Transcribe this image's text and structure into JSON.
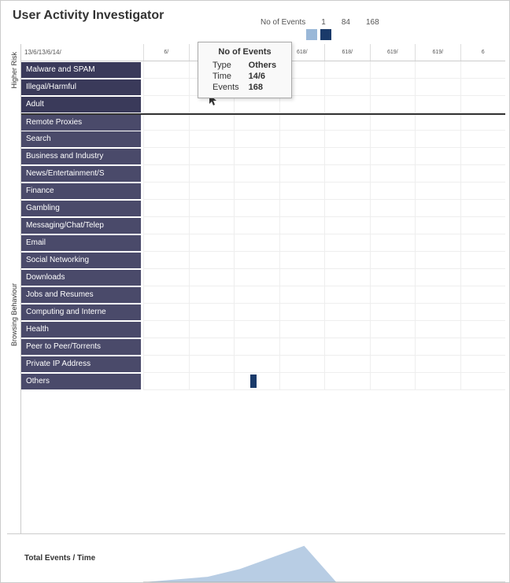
{
  "title": "User Activity Investigator",
  "legend": {
    "label": "No of Events",
    "values": [
      "1",
      "84",
      "168"
    ],
    "colors": [
      "#9ab8d8",
      "#1a3a6a"
    ]
  },
  "timeHeader": "13/6/13/6/14/",
  "timeHeaderRight": "6/617/617/618/618/619/619/6",
  "categories": {
    "higherRisk": {
      "label": "Higher Risk",
      "items": [
        "Malware and SPAM",
        "Illegal/Harmful",
        "Adult"
      ]
    },
    "browsing": {
      "label": "Browsing Behaviour",
      "items": [
        "Remote Proxies",
        "Search",
        "Business and Industry",
        "News/Entertainment/S",
        "Finance",
        "Gambling",
        "Messaging/Chat/Telep",
        "Email",
        "Social Networking",
        "Downloads",
        "Jobs and Resumes",
        "Computing and Interne",
        "Health",
        "Peer to Peer/Torrents",
        "Private IP Address",
        "Others"
      ]
    }
  },
  "tooltip": {
    "title": "No of Events",
    "type_label": "Type",
    "type_value": "Others",
    "time_label": "Time",
    "time_value": "14/6",
    "events_label": "Events",
    "events_value": "168"
  },
  "bottomLabel": "Total Events / Time",
  "columns": [
    "col1",
    "col2",
    "col3",
    "col4",
    "col5",
    "col6",
    "col7",
    "col8",
    "col9",
    "col10",
    "col11",
    "col12"
  ],
  "bars": {
    "others_col3": true
  }
}
